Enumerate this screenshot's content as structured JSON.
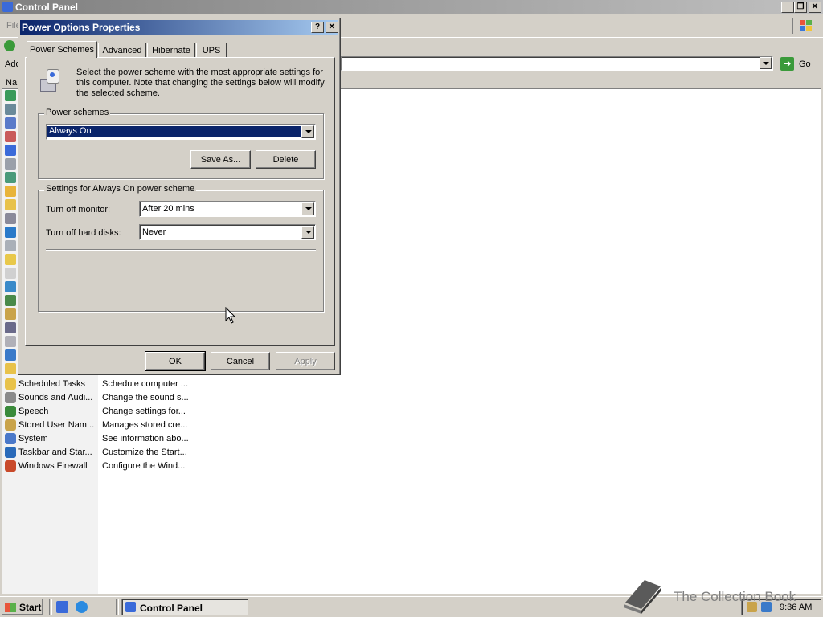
{
  "control_panel": {
    "title": "Control Panel",
    "menu_first": "File",
    "address_label": "Add",
    "go_label": "Go",
    "column_name": "Na",
    "items": [
      {
        "name": "Scheduled Tasks",
        "desc": "Schedule computer ...",
        "color": "#e8c24a"
      },
      {
        "name": "Sounds and Audi...",
        "desc": "Change the sound s...",
        "color": "#8a8a8a"
      },
      {
        "name": "Speech",
        "desc": "Change settings for...",
        "color": "#3a8a3a"
      },
      {
        "name": "Stored User Nam...",
        "desc": "Manages stored cre...",
        "color": "#c9a34a"
      },
      {
        "name": "System",
        "desc": "See information abo...",
        "color": "#4a78c9"
      },
      {
        "name": "Taskbar and Star...",
        "desc": "Customize the Start...",
        "color": "#2a6ab9"
      },
      {
        "name": "Windows Firewall",
        "desc": "Configure the Wind...",
        "color": "#c94a2a"
      }
    ]
  },
  "dialog": {
    "title": "Power Options Properties",
    "tabs": [
      "Power Schemes",
      "Advanced",
      "Hibernate",
      "UPS"
    ],
    "description": "Select the power scheme with the most appropriate settings for this computer. Note that changing the settings below will modify the selected scheme.",
    "schemes_group": "Power schemes",
    "scheme_value": "Always On",
    "save_as": "Save As...",
    "delete": "Delete",
    "settings_group": "Settings for Always On power scheme",
    "monitor_label": "Turn off monitor:",
    "monitor_value": "After 20 mins",
    "disks_label": "Turn off hard disks:",
    "disks_value": "Never",
    "ok": "OK",
    "cancel": "Cancel",
    "apply": "Apply"
  },
  "taskbar": {
    "start": "Start",
    "task_label": "Control Panel",
    "clock": "9:36 AM"
  },
  "watermark": "The Collection Book",
  "colors": {
    "titlebar_active": "#0a246a",
    "titlebar_inactive": "#808080",
    "face": "#d4d0c8",
    "selection": "#0a246a"
  }
}
